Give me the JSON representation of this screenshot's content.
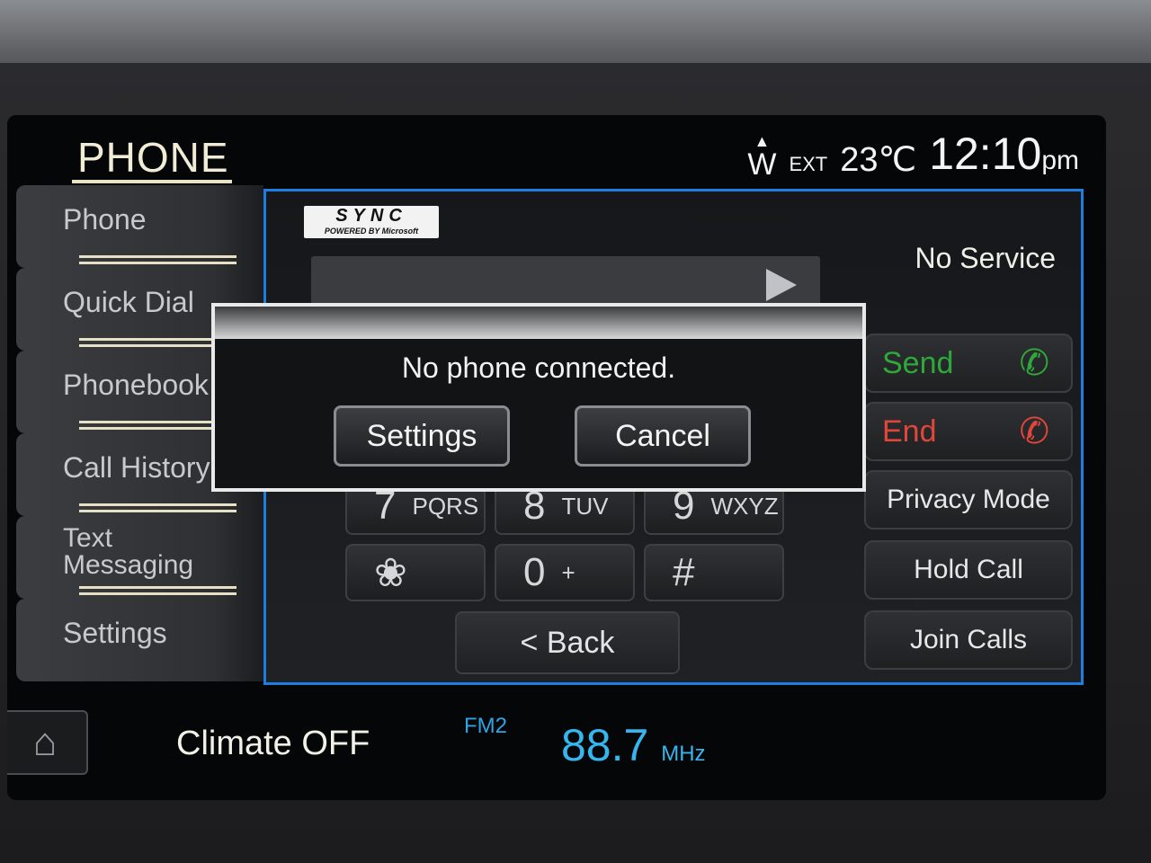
{
  "header": {
    "title": "PHONE",
    "compass": "W",
    "ext_label": "EXT",
    "temperature": "23℃",
    "time": "12:10",
    "time_suffix": "pm"
  },
  "sidebar": {
    "items": [
      {
        "label": "Phone"
      },
      {
        "label": "Quick Dial"
      },
      {
        "label": "Phonebook"
      },
      {
        "label": "Call History"
      },
      {
        "label": "Text Messaging"
      },
      {
        "label": "Settings"
      }
    ]
  },
  "phone": {
    "logo_main": "SYNC",
    "logo_sub": "POWERED BY Microsoft",
    "status": "No Service",
    "keypad": [
      {
        "num": "7",
        "letters": "PQRS"
      },
      {
        "num": "8",
        "letters": "TUV"
      },
      {
        "num": "9",
        "letters": "WXYZ"
      },
      {
        "num": "❀",
        "letters": ""
      },
      {
        "num": "0",
        "letters": "+"
      },
      {
        "num": "#",
        "letters": ""
      }
    ],
    "back_label": "< Back",
    "actions": {
      "send": "Send",
      "end": "End",
      "privacy": "Privacy Mode",
      "hold": "Hold Call",
      "join": "Join Calls"
    }
  },
  "dialog": {
    "message": "No phone connected.",
    "settings_label": "Settings",
    "cancel_label": "Cancel"
  },
  "footer": {
    "climate": "Climate OFF",
    "band": "FM2",
    "frequency": "88.7",
    "unit": "MHz"
  },
  "colors": {
    "accent_blue": "#1d7ee0",
    "send_green": "#2fa83a",
    "end_red": "#e1463a",
    "radio_blue": "#35b6ef"
  }
}
